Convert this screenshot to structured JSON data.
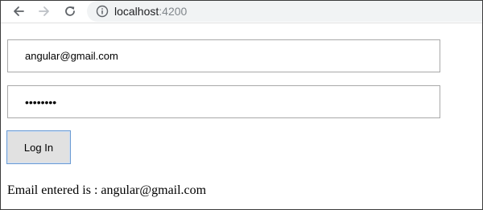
{
  "browser": {
    "url_host": "localhost",
    "url_port": ":4200",
    "icons": {
      "back": "arrow-left-icon",
      "forward": "arrow-right-icon",
      "reload": "reload-icon",
      "site_info": "info-circle-icon"
    }
  },
  "form": {
    "email_value": "angular@gmail.com",
    "password_masked": "••••••••",
    "login_label": "Log In"
  },
  "result": {
    "prefix": "Email entered is : ",
    "email": "angular@gmail.com"
  },
  "colors": {
    "button_border": "#6c9bd2",
    "button_fill": "#e1e1e1",
    "address_bar_bg": "#f1f3f4",
    "port_text": "#80868b"
  }
}
